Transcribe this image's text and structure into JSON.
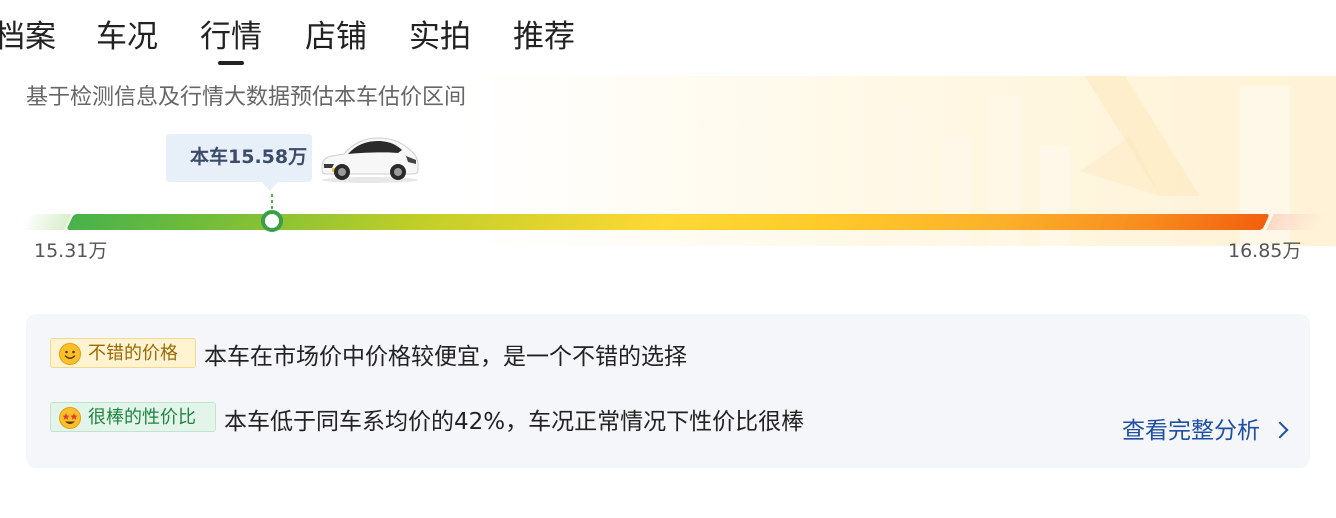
{
  "tabs": [
    {
      "label": "档案",
      "active": false
    },
    {
      "label": "车况",
      "active": false
    },
    {
      "label": "行情",
      "active": true
    },
    {
      "label": "店铺",
      "active": false
    },
    {
      "label": "实拍",
      "active": false
    },
    {
      "label": "推荐",
      "active": false
    }
  ],
  "valuation": {
    "subtitle": "基于检测信息及行情大数据预估本车估价区间",
    "current_price_label": "本车15.58万",
    "range_min_label": "15.31万",
    "range_max_label": "16.85万",
    "range_min": 15.31,
    "range_max": 16.85,
    "current_price": 15.58,
    "car_image": "white-suv-icon"
  },
  "analysis": {
    "items": [
      {
        "tag": "不错的价格",
        "tag_icon": "smile-emoji-icon",
        "text": "本车在市场价中价格较便宜，是一个不错的选择"
      },
      {
        "tag": "很棒的性价比",
        "tag_icon": "star-eyes-emoji-icon",
        "text": "本车低于同车系均价的42%，车况正常情况下性价比很棒"
      }
    ],
    "link_label": "查看完整分析"
  },
  "colors": {
    "bar_start": "#47b24c",
    "bar_mid": "#ffd835",
    "bar_end": "#f25f0e",
    "link": "#1f4fa3",
    "good_tag": "#9a6a05",
    "great_tag": "#20853f"
  }
}
